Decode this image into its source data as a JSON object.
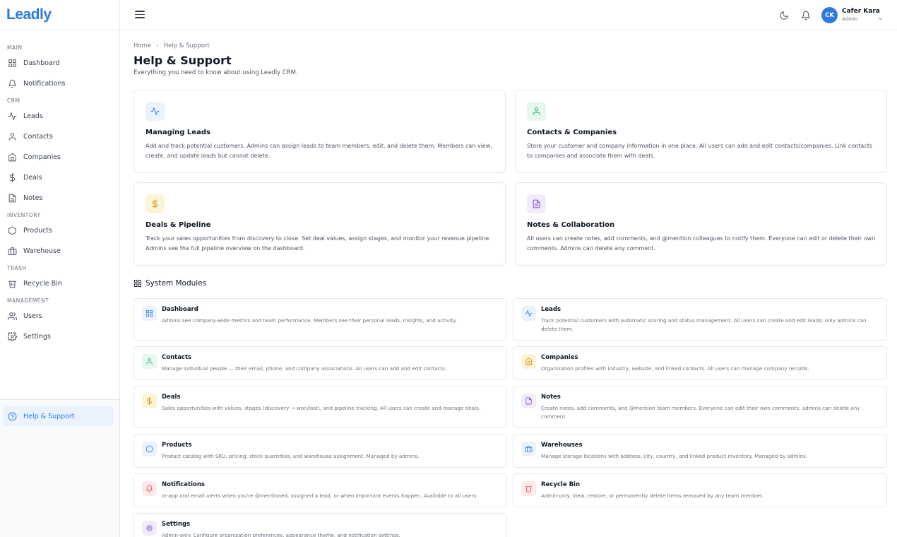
{
  "app": {
    "logo_text": "Leadly"
  },
  "sidebar": {
    "sections": {
      "main": "MAIN",
      "crm": "CRM",
      "inventory": "INVENTORY",
      "trash": "TRASH",
      "management": "MANAGEMENT"
    },
    "items": {
      "dashboard": "Dashboard",
      "notifications": "Notifications",
      "leads": "Leads",
      "contacts": "Contacts",
      "companies": "Companies",
      "deals": "Deals",
      "notes": "Notes",
      "products": "Products",
      "warehouse": "Warehouse",
      "recycle_bin": "Recycle Bin",
      "users": "Users",
      "settings": "Settings",
      "help": "Help & Support"
    }
  },
  "topbar": {
    "user": {
      "initials": "CK",
      "name": "Cafer Kara",
      "role": "Admin"
    },
    "icons": [
      "menu-icon",
      "moon-icon",
      "bell-icon",
      "chevron-down-icon"
    ],
    "accent_color": "#2b7be0"
  },
  "page": {
    "breadcrumb": {
      "home": "Home",
      "current": "Help & Support"
    },
    "title": "Help & Support",
    "subtitle": "Everything you need to know about using Leadly CRM."
  },
  "guides": [
    {
      "title": "Managing Leads",
      "desc": "Add and track potential customers. Admins can assign leads to team members, edit, and delete them. Members can view, create, and update leads but cannot delete.",
      "icon": "activity-icon",
      "color": "#2b7be0"
    },
    {
      "title": "Contacts & Companies",
      "desc": "Store your customer and company information in one place. All users can add and edit contacts/companies. Link contacts to companies and associate them with deals.",
      "icon": "user-icon",
      "color": "#22a55a"
    },
    {
      "title": "Deals & Pipeline",
      "desc": "Track your sales opportunities from discovery to close. Set deal values, assign stages, and monitor your revenue pipeline. Admins see the full pipeline overview on the dashboard.",
      "icon": "dollar-icon",
      "color": "#c58a0a"
    },
    {
      "title": "Notes & Collaboration",
      "desc": "All users can create notes, add comments, and @mention colleagues to notify them. Everyone can edit or delete their own comments. Admins can delete any comment.",
      "icon": "file-text-icon",
      "color": "#7c4dcf"
    }
  ],
  "modules_heading": "System Modules",
  "modules": [
    {
      "title": "Dashboard",
      "desc": "Admins see company-wide metrics and team performance. Members see their personal leads, insights, and activity.",
      "icon": "grid-icon",
      "color": "#2b7be0"
    },
    {
      "title": "Leads",
      "desc": "Track potential customers with automatic scoring and status management. All users can create and edit leads; only admins can delete them.",
      "icon": "activity-icon",
      "color": "#2b7be0"
    },
    {
      "title": "Contacts",
      "desc": "Manage individual people — their email, phone, and company associations. All users can add and edit contacts.",
      "icon": "user-icon",
      "color": "#22a55a"
    },
    {
      "title": "Companies",
      "desc": "Organization profiles with industry, website, and linked contacts. All users can manage company records.",
      "icon": "building-icon",
      "color": "#c58a0a"
    },
    {
      "title": "Deals",
      "desc": "Sales opportunities with values, stages (discovery → won/lost), and pipeline tracking. All users can create and manage deals.",
      "icon": "dollar-icon",
      "color": "#c58a0a"
    },
    {
      "title": "Notes",
      "desc": "Create notes, add comments, and @mention team members. Everyone can edit their own comments; admins can delete any comment.",
      "icon": "file-text-icon",
      "color": "#7c4dcf"
    },
    {
      "title": "Products",
      "desc": "Product catalog with SKU, pricing, stock quantities, and warehouse assignment. Managed by admins.",
      "icon": "box-icon",
      "color": "#2b7be0"
    },
    {
      "title": "Warehouses",
      "desc": "Manage storage locations with address, city, country, and linked product inventory. Managed by admins.",
      "icon": "warehouse-icon",
      "color": "#2b7be0"
    },
    {
      "title": "Notifications",
      "desc": "In-app and email alerts when you're @mentioned, assigned a lead, or when important events happen. Available to all users.",
      "icon": "bell-icon",
      "color": "#e0434f"
    },
    {
      "title": "Recycle Bin",
      "desc": "Admin-only. View, restore, or permanently delete items removed by any team member.",
      "icon": "trash-icon",
      "color": "#e0434f"
    },
    {
      "title": "Settings",
      "desc": "Admin-only. Configure organization preferences, appearance theme, and notification settings.",
      "icon": "gear-icon",
      "color": "#7c4dcf"
    }
  ]
}
